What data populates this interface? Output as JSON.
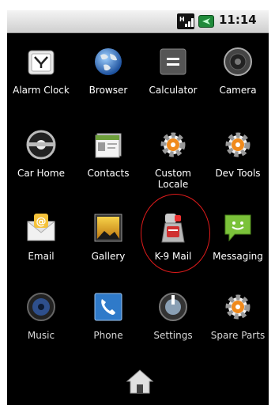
{
  "status": {
    "time": "11:14"
  },
  "apps": [
    {
      "label": "Alarm Clock",
      "icon": "alarm-clock-icon"
    },
    {
      "label": "Browser",
      "icon": "globe-icon"
    },
    {
      "label": "Calculator",
      "icon": "calculator-icon"
    },
    {
      "label": "Camera",
      "icon": "camera-icon"
    },
    {
      "label": "Car Home",
      "icon": "car-home-icon"
    },
    {
      "label": "Contacts",
      "icon": "contacts-icon"
    },
    {
      "label": "Custom Locale",
      "icon": "gear-icon"
    },
    {
      "label": "Dev Tools",
      "icon": "gear-icon"
    },
    {
      "label": "Email",
      "icon": "envelope-icon"
    },
    {
      "label": "Gallery",
      "icon": "gallery-icon"
    },
    {
      "label": "K-9 Mail",
      "icon": "k9-dog-icon"
    },
    {
      "label": "Messaging",
      "icon": "chat-bubble-icon"
    },
    {
      "label": "Music",
      "icon": "speaker-icon"
    },
    {
      "label": "Phone",
      "icon": "phone-handset-icon"
    },
    {
      "label": "Settings",
      "icon": "settings-dial-icon"
    },
    {
      "label": "Spare Parts",
      "icon": "gear-icon"
    }
  ],
  "home": {
    "icon": "home-icon"
  },
  "highlight": {
    "target": "K-9 Mail",
    "color": "#e01b1b"
  }
}
